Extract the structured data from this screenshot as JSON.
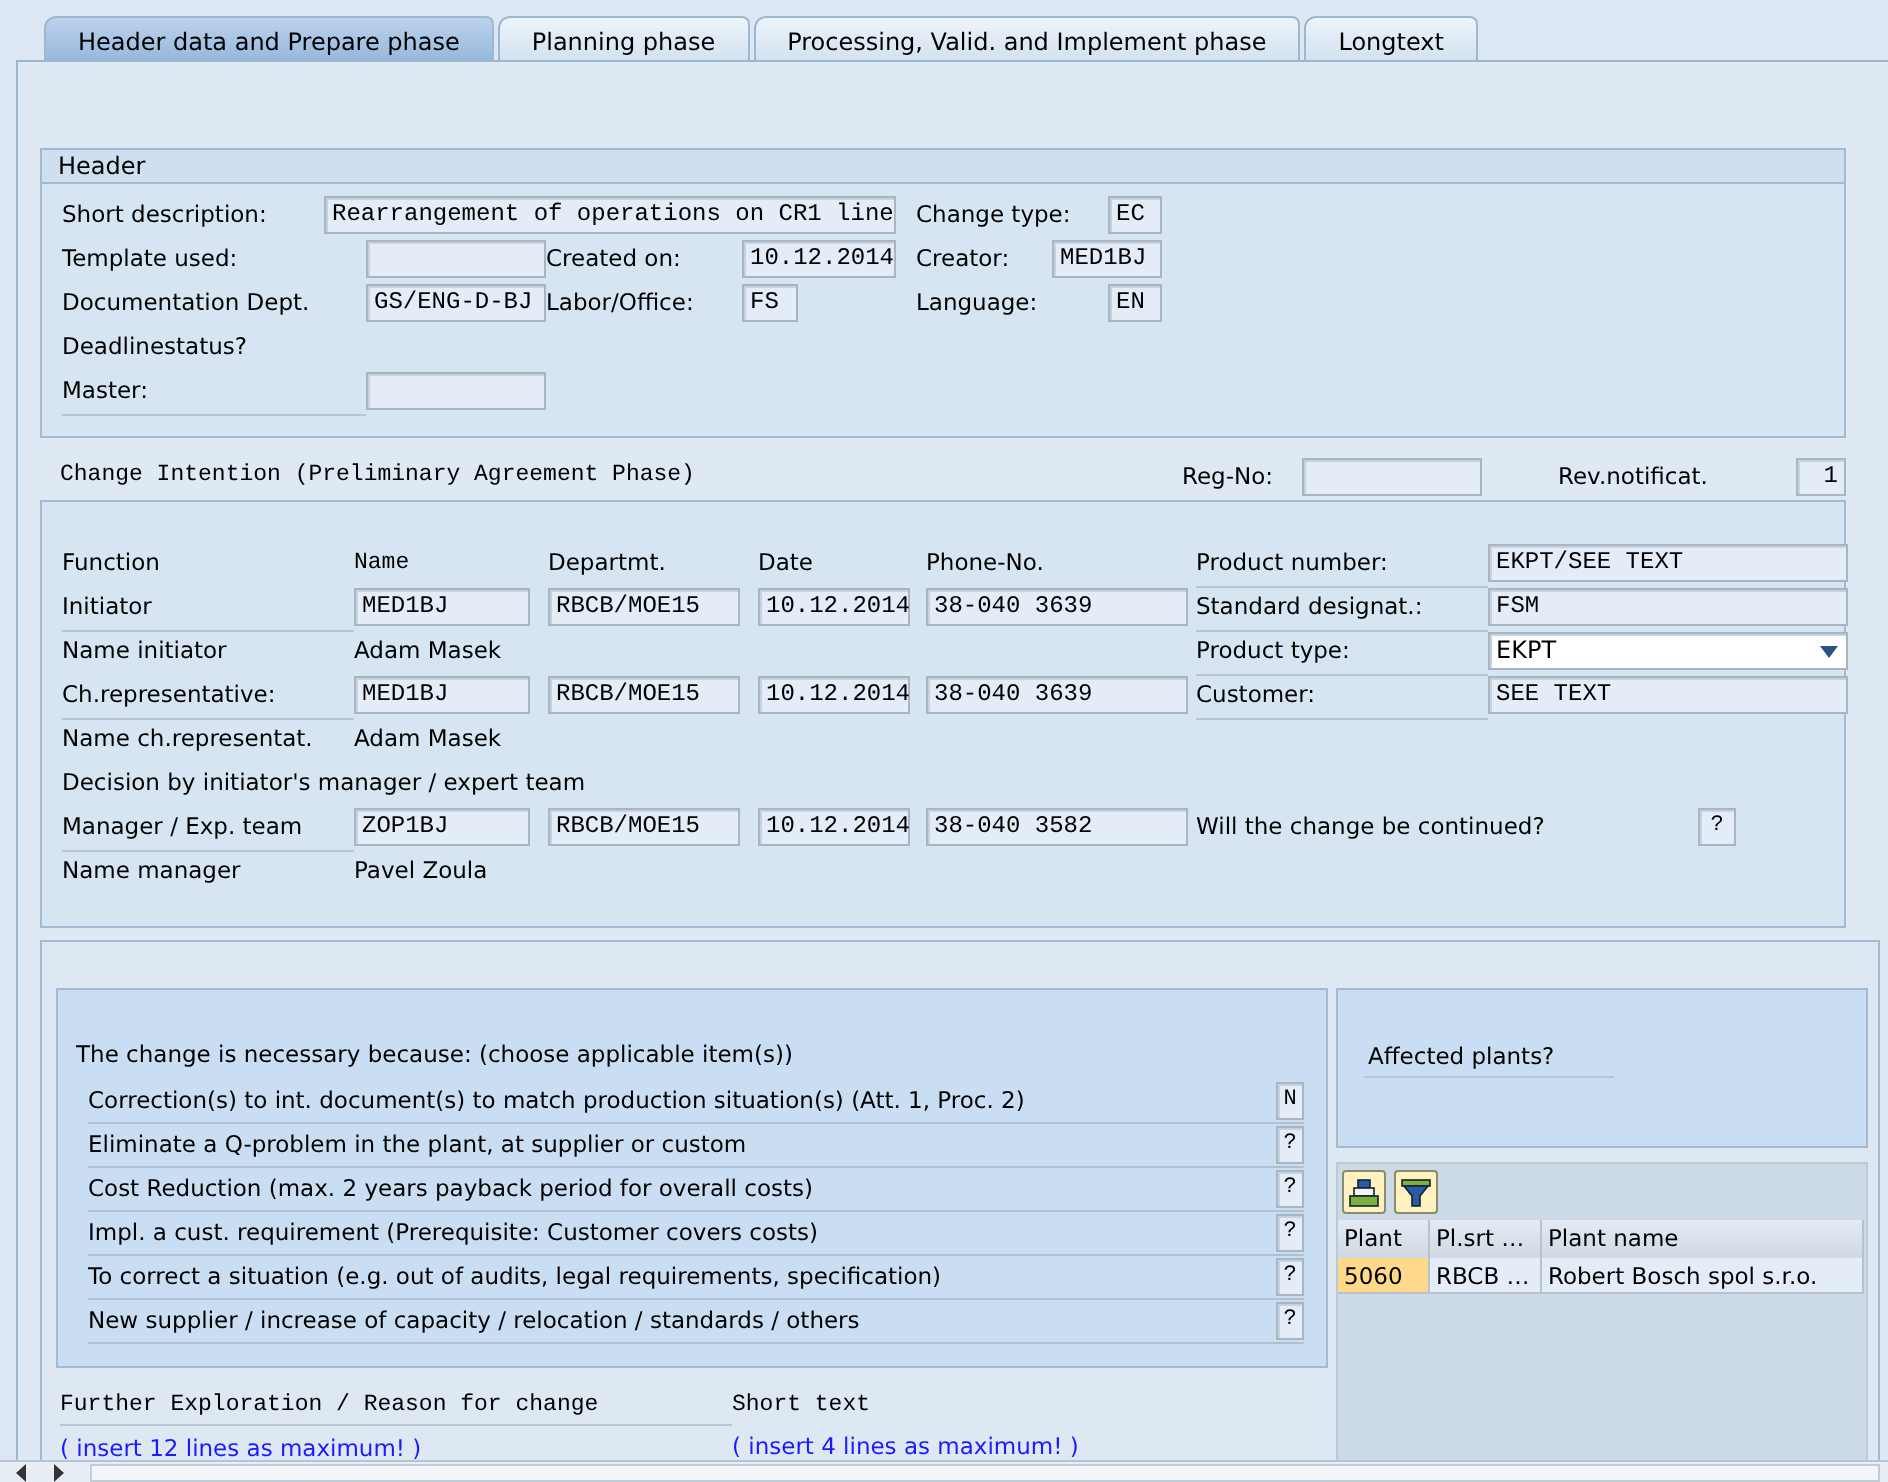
{
  "tabs": [
    {
      "label": "Header data and Prepare phase",
      "selected": true
    },
    {
      "label": "Planning phase",
      "selected": false
    },
    {
      "label": "Processing, Valid. and Implement phase",
      "selected": false
    },
    {
      "label": "Longtext",
      "selected": false
    }
  ],
  "header": {
    "title": "Header",
    "short_description": {
      "label": "Short description:",
      "value": "Rearrangement of operations on CR1 line"
    },
    "change_type": {
      "label": "Change type:",
      "value": "EC"
    },
    "template_used": {
      "label": "Template used:"
    },
    "created_on": {
      "label": "Created on:",
      "value": "10.12.2014"
    },
    "creator": {
      "label": "Creator:",
      "value": "MED1BJ"
    },
    "documentation_dept": {
      "label": "Documentation Dept.",
      "value": "GS/ENG-D-BJ"
    },
    "labor_office": {
      "label": "Labor/Office:",
      "value": "FS"
    },
    "language": {
      "label": "Language:",
      "value": "EN"
    },
    "deadline_status": {
      "label": "Deadlinestatus?"
    },
    "master": {
      "label": "Master:"
    }
  },
  "change_intention": {
    "title": "Change Intention (Preliminary Agreement Phase)",
    "reg_no": {
      "label": "Reg-No:"
    },
    "rev_notificat": {
      "label": "Rev.notificat.",
      "value": "1"
    },
    "columns": [
      "Function",
      "Name",
      "Departmt.",
      "Date",
      "Phone-No."
    ],
    "initiator": {
      "label": "Initiator",
      "name": "MED1BJ",
      "dept": "RBCB/MOE15",
      "date": "10.12.2014",
      "phone": "38-040 3639"
    },
    "name_initiator": {
      "label": "Name initiator",
      "value": "Adam Masek"
    },
    "ch_representative": {
      "label": "Ch.representative:",
      "name": "MED1BJ",
      "dept": "RBCB/MOE15",
      "date": "10.12.2014",
      "phone": "38-040 3639"
    },
    "name_ch_representative": {
      "label": "Name ch.representat.",
      "value": "Adam Masek"
    },
    "decision": "Decision by initiator's manager / expert team",
    "manager": {
      "label": "Manager / Exp. team",
      "name": "ZOP1BJ",
      "dept": "RBCB/MOE15",
      "date": "10.12.2014",
      "phone": "38-040 3582"
    },
    "name_manager": {
      "label": "Name manager",
      "value": "Pavel Zoula"
    },
    "product_number": {
      "label": "Product number:",
      "value": "EKPT/SEE TEXT"
    },
    "standard_designat": {
      "label": "Standard designat.:",
      "value": "FSM"
    },
    "product_type": {
      "label": "Product type:",
      "value": "EKPT"
    },
    "customer": {
      "label": "Customer:",
      "value": "SEE TEXT"
    },
    "continued": {
      "label": "Will the change be continued?",
      "value": "?"
    }
  },
  "reasons": {
    "title": "The change is necessary because: (choose applicable item(s))",
    "items": [
      {
        "text": "Correction(s) to int. document(s) to match production situation(s) (Att. 1, Proc. 2)",
        "value": "N"
      },
      {
        "text": "Eliminate a Q-problem in the plant, at supplier or custom",
        "value": "?"
      },
      {
        "text": "Cost Reduction (max. 2 years payback period for overall costs)",
        "value": "?"
      },
      {
        "text": "Impl. a cust. requirement (Prerequisite: Customer covers costs)",
        "value": "?"
      },
      {
        "text": "To correct a situation (e.g. out of audits, legal requirements, specification)",
        "value": "?"
      },
      {
        "text": "New supplier / increase of capacity / relocation / standards / others",
        "value": "?"
      }
    ]
  },
  "further_exploration": {
    "label": "Further Exploration / Reason for change",
    "link": "( insert 12 lines as maximum! )"
  },
  "short_text": {
    "label": "Short text",
    "link": "( insert 4 lines as maximum! )"
  },
  "affected_plants": {
    "label": "Affected plants?",
    "columns": [
      "Plant",
      "Pl.srt …",
      "Plant name"
    ],
    "rows": [
      {
        "cells": [
          "5060",
          "RBCB …",
          "Robert Bosch spol  s.r.o."
        ],
        "selected": true
      }
    ]
  }
}
